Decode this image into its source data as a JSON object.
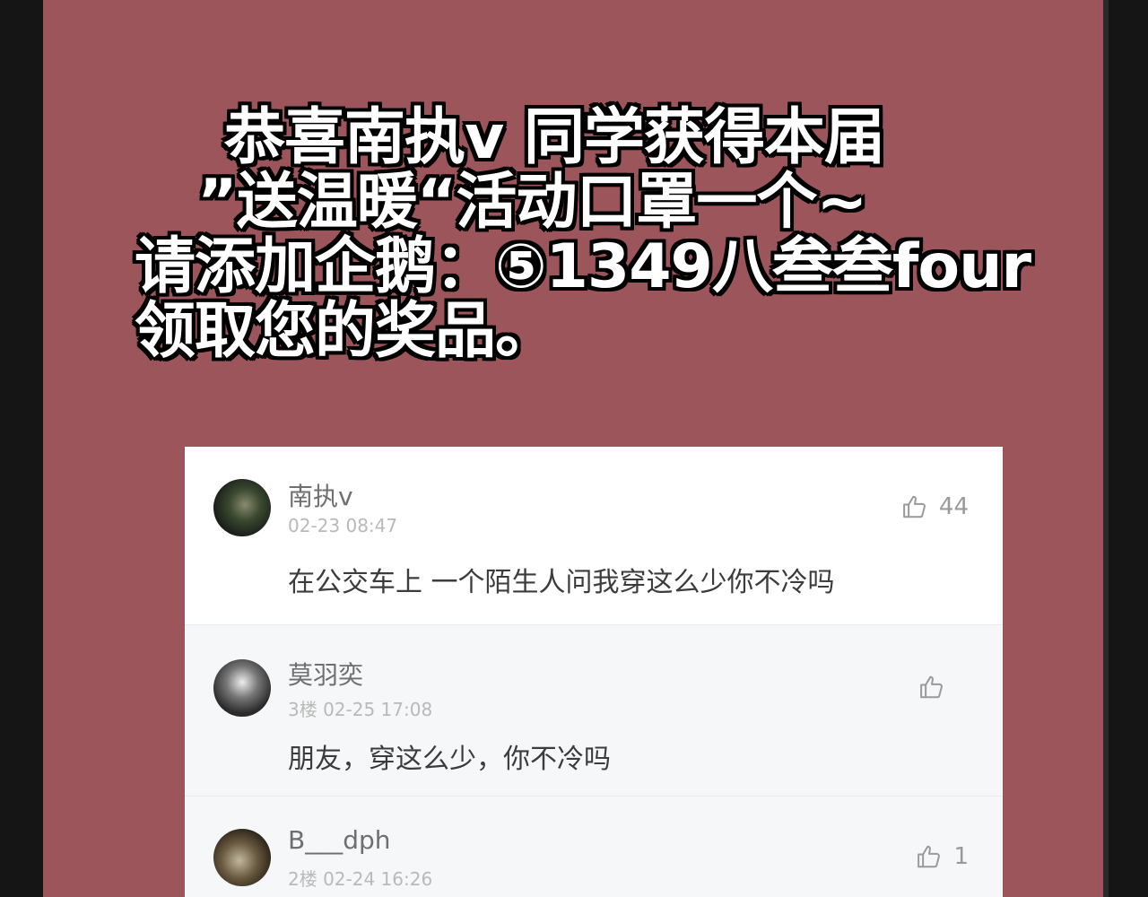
{
  "banner": {
    "line1": "恭喜南执v 同学获得本届",
    "line2": "”送温暖“活动口罩一个~",
    "line3": "请添加企鹅：⑤1349八叁叁four",
    "line4": "领取您的奖品。"
  },
  "post": {
    "username": "南执v",
    "time": "02-23 08:47",
    "likes": "44",
    "content": "在公交车上 一个陌生人问我穿这么少你不冷吗"
  },
  "replies": [
    {
      "username": "莫羽奕",
      "time": "3楼 02-25 17:08",
      "likes": "",
      "content": "朋友，穿这么少，你不冷吗"
    },
    {
      "username": "B___dph",
      "time": "2楼 02-24 16:26",
      "likes": "1",
      "content": ""
    }
  ],
  "icons": {
    "like": "thumbs-up-icon"
  },
  "colors": {
    "panel": "#9c565b",
    "card": "#ffffff",
    "reply_bg": "#f6f7f9"
  }
}
